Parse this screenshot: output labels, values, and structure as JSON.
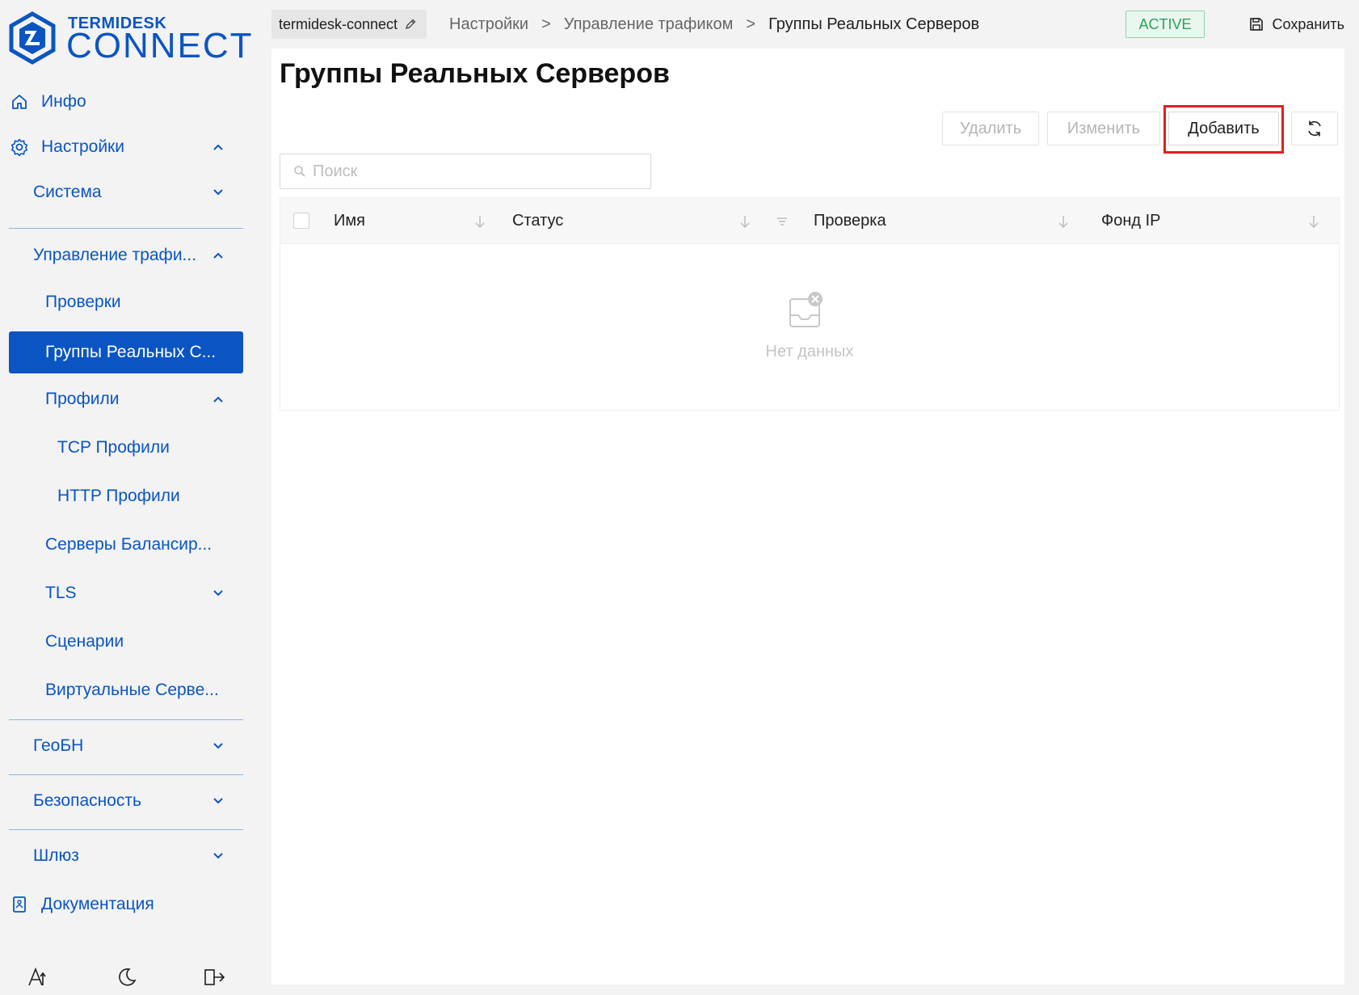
{
  "brand": {
    "line1": "TERMIDESK",
    "line2": "CONNECT"
  },
  "sidebar": {
    "info": "Инфо",
    "settings": "Настройки",
    "system": "Система",
    "traffic": "Управление трафи...",
    "checks": "Проверки",
    "real_groups": "Группы Реальных С...",
    "profiles": "Профили",
    "tcp_profiles": "TCP Профили",
    "http_profiles": "HTTP Профили",
    "balancer_servers": "Серверы Балансир...",
    "tls": "TLS",
    "scenarios": "Сценарии",
    "virtual_servers": "Виртуальные Серве...",
    "geobn": "ГеоБН",
    "security": "Безопасность",
    "gateway": "Шлюз",
    "docs": "Документация"
  },
  "header": {
    "instance": "termidesk-connect",
    "crumbs": [
      "Настройки",
      "Управление трафиком",
      "Группы Реальных Серверов"
    ],
    "separator": ">",
    "status": "ACTIVE",
    "save_label": "Сохранить"
  },
  "main": {
    "title": "Группы Реальных Серверов",
    "delete_label": "Удалить",
    "edit_label": "Изменить",
    "add_label": "Добавить",
    "search_placeholder": "Поиск",
    "columns": [
      "Имя",
      "Статус",
      "Проверка",
      "Фонд IP"
    ],
    "empty_text": "Нет данных"
  },
  "colors": {
    "accent": "#0a55c1",
    "status": "#2ba15b",
    "highlight": "#e02020"
  }
}
